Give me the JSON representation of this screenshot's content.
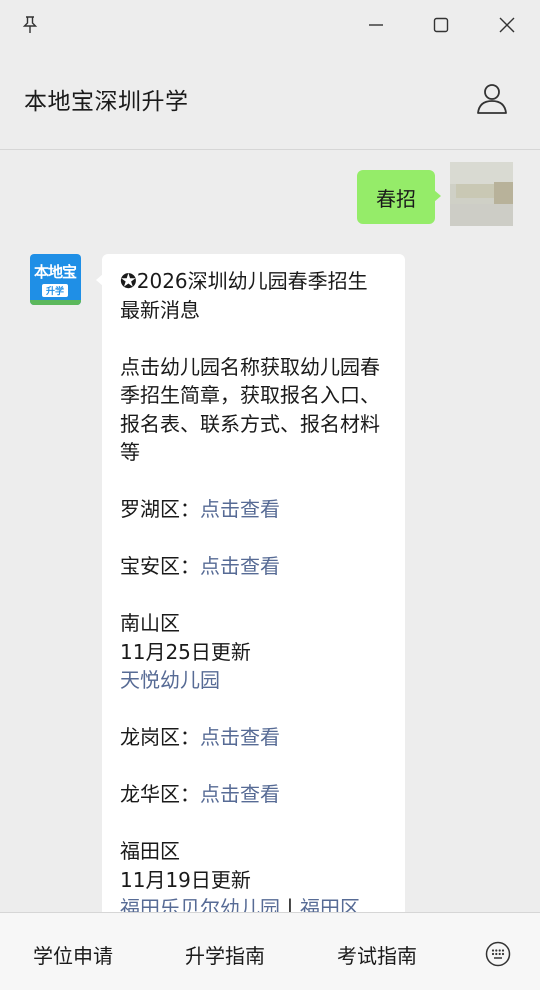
{
  "window": {
    "pin_icon": "pin-icon",
    "minimize_icon": "minimize-icon",
    "maximize_icon": "maximize-icon",
    "close_icon": "close-icon"
  },
  "header": {
    "title": "本地宝深圳升学",
    "profile_icon": "person-icon"
  },
  "messages": {
    "user": {
      "text": "春招"
    },
    "bot": {
      "avatar_text": "本地宝",
      "avatar_badge": "升学",
      "title": "✪2026深圳幼儿园春季招生最新消息",
      "intro": "点击幼儿园名称获取幼儿园春季招生简章，获取报名入口、报名表、联系方式、报名材料等",
      "luohu_label": "罗湖区：",
      "luohu_link": "点击查看",
      "baoan_label": "宝安区：",
      "baoan_link": "点击查看",
      "nanshan_label": "南山区",
      "nanshan_update": "11月25日更新",
      "nanshan_link": "天悦幼儿园",
      "longgang_label": "龙岗区：",
      "longgang_link": "点击查看",
      "longhua_label": "龙华区：",
      "longhua_link": "点击查看",
      "futian_label": "福田区",
      "futian_update": "11月19日更新",
      "futian_link1": "福田乐贝尔幼儿园",
      "futian_sep": "丨",
      "futian_link2": "福田区"
    }
  },
  "bottom_menu": {
    "item1": "学位申请",
    "item2": "升学指南",
    "item3": "考试指南",
    "keyboard_icon": "keyboard-icon"
  },
  "colors": {
    "background": "#ededed",
    "user_bubble": "#95ec69",
    "link": "#576b95",
    "brand_blue": "#1f8fe6"
  }
}
